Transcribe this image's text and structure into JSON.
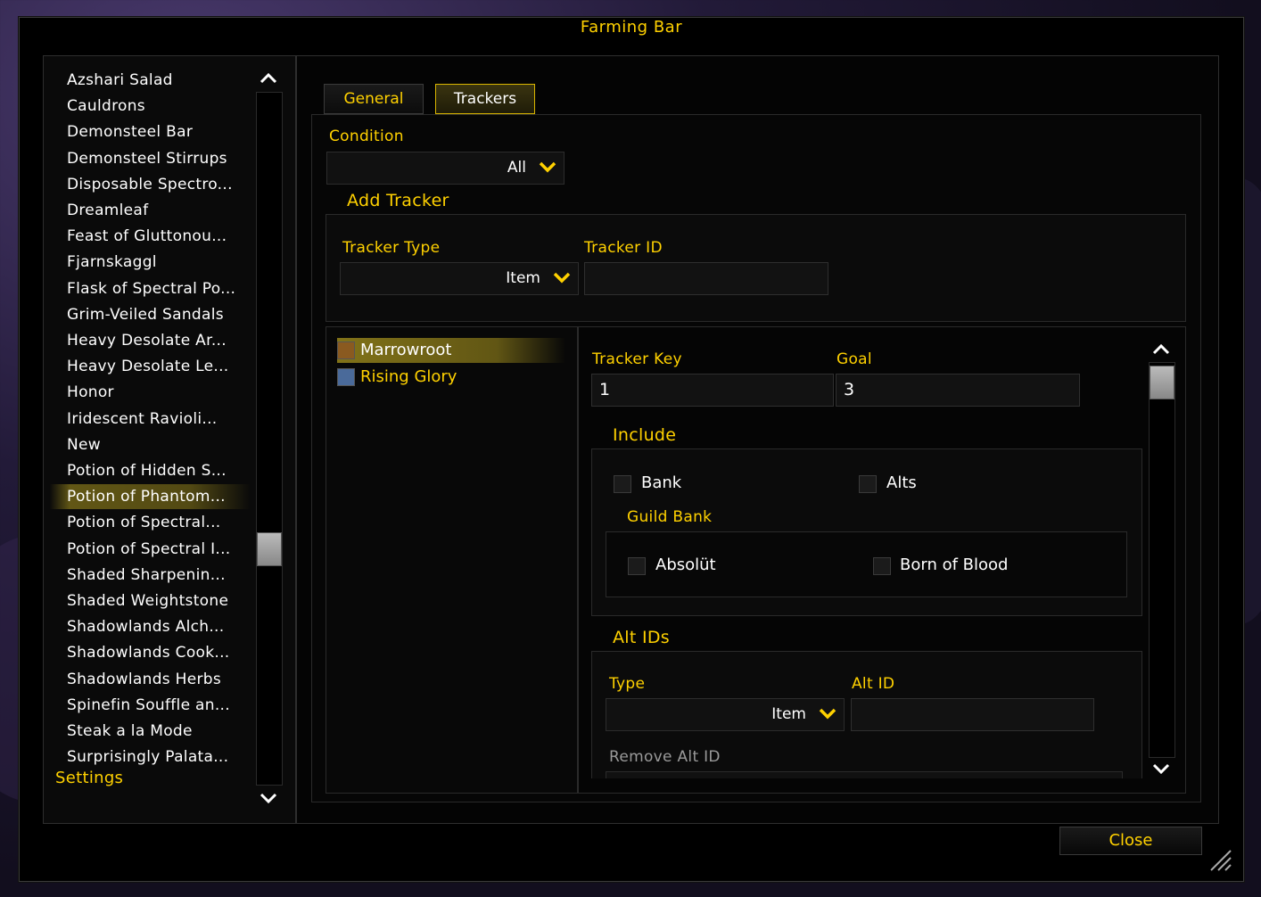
{
  "window": {
    "title": "Farming Bar"
  },
  "sidebar": {
    "items": [
      "Azshari Salad",
      "Cauldrons",
      "Demonsteel Bar",
      "Demonsteel Stirrups",
      "Disposable Spectro...",
      "Dreamleaf",
      "Feast of Gluttonou...",
      "Fjarnskaggl",
      "Flask of Spectral Po...",
      "Grim-Veiled Sandals",
      "Heavy Desolate Ar...",
      "Heavy Desolate Le...",
      "Honor",
      "Iridescent Ravioli...",
      "New",
      "Potion of Hidden S...",
      "Potion of Phantom...",
      "Potion of Spectral...",
      "Potion of Spectral I...",
      "Shaded Sharpenin...",
      "Shaded Weightstone",
      "Shadowlands Alch...",
      "Shadowlands Cook...",
      "Shadowlands Herbs",
      "Spinefin Souffle an...",
      "Steak a la Mode",
      "Surprisingly Palata..."
    ],
    "selected_index": 16,
    "settings_label": "Settings"
  },
  "tabs": {
    "general": "General",
    "trackers": "Trackers"
  },
  "condition": {
    "label": "Condition",
    "value": "All"
  },
  "add_tracker": {
    "heading": "Add Tracker",
    "type_label": "Tracker Type",
    "type_value": "Item",
    "id_label": "Tracker ID",
    "id_value": ""
  },
  "trackers": [
    {
      "name": "Marrowroot",
      "selected": true
    },
    {
      "name": "Rising Glory",
      "selected": false
    }
  ],
  "detail": {
    "key_label": "Tracker Key",
    "key_value": "1",
    "goal_label": "Goal",
    "goal_value": "3",
    "include_heading": "Include",
    "bank_label": "Bank",
    "alts_label": "Alts",
    "guild_bank_heading": "Guild Bank",
    "guild1_label": "Absolüt",
    "guild2_label": "Born of Blood",
    "alt_ids_heading": "Alt IDs",
    "type_label": "Type",
    "type_value": "Item",
    "alt_id_label": "Alt ID",
    "alt_id_value": "",
    "remove_label": "Remove Alt ID"
  },
  "footer": {
    "close_label": "Close"
  },
  "colors": {
    "accent": "#ffd100",
    "background": "#000000"
  }
}
